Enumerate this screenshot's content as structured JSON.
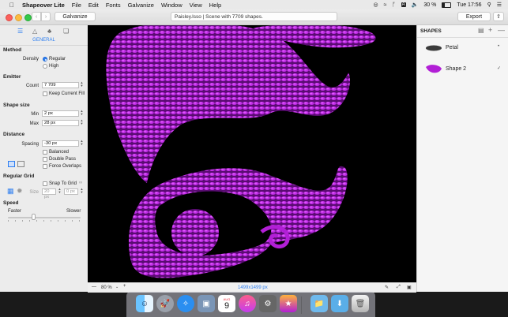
{
  "menubar": {
    "app_name": "Shapeover Lite",
    "items": [
      "File",
      "Edit",
      "Fonts",
      "Galvanize",
      "Window",
      "View",
      "Help"
    ],
    "battery": "30 %",
    "clock": "Tue 17:56"
  },
  "toolbar": {
    "galvanize_label": "Galvanize",
    "doc_title": "Paisley.lsso | Scene with 7709 shapes.",
    "export_label": "Export"
  },
  "left": {
    "tab_title": "GENERAL",
    "method": {
      "title": "Method",
      "density_label": "Density",
      "options": [
        "Regular",
        "High"
      ],
      "selected": "Regular"
    },
    "emitter": {
      "title": "Emitter",
      "count_label": "Count",
      "count_value": "7 709",
      "keep_fill_label": "Keep Current Fill"
    },
    "shape_size": {
      "title": "Shape size",
      "min_label": "Min",
      "min_value": "2 px",
      "max_label": "Max",
      "max_value": "28 px"
    },
    "distance": {
      "title": "Distance",
      "spacing_label": "Spacing",
      "spacing_value": "-30 px",
      "options": [
        "Balanced",
        "Double Pass",
        "Force Overlaps"
      ]
    },
    "regular_grid": {
      "title": "Regular Grid",
      "snap_label": "Snap To Grid",
      "size_label": "Size",
      "size_w": "20 px",
      "size_h": "0 px"
    },
    "speed": {
      "title": "Speed",
      "faster": "Faster",
      "slower": "Slower",
      "value": 0.35
    }
  },
  "canvas": {
    "zoom": "80 %",
    "dimensions": "1499x1499 px",
    "accent": "#b21fd6"
  },
  "right": {
    "title": "SHAPES",
    "shapes": [
      {
        "name": "Petal",
        "color": "#3a3a3a"
      },
      {
        "name": "Shape 2",
        "color": "#b21fd6"
      }
    ]
  },
  "dock": {
    "calendar_month": "AUG",
    "calendar_day": "9"
  }
}
